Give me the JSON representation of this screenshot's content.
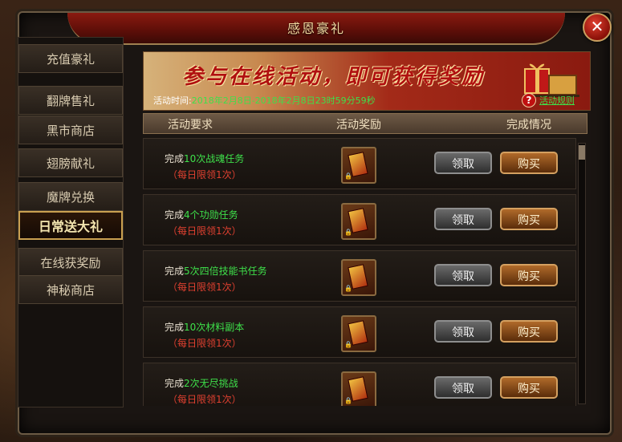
{
  "window": {
    "title": "感恩豪礼"
  },
  "sidebar": {
    "items": [
      {
        "label": "充值豪礼",
        "active": false
      },
      {
        "label": "翻牌售礼",
        "active": false
      },
      {
        "label": "黑市商店",
        "active": false
      },
      {
        "label": "翅膀献礼",
        "active": false
      },
      {
        "label": "魔牌兑换",
        "active": false
      },
      {
        "label": "日常送大礼",
        "active": true
      },
      {
        "label": "在线获奖励",
        "active": false
      },
      {
        "label": "神秘商店",
        "active": false
      }
    ]
  },
  "banner": {
    "headline": "参与在线活动，即可获得奖励",
    "time_label": "活动时间:",
    "time_value": "2018年2月8日-2018年2月8日23时59分59秒",
    "rules_link": "活动规则"
  },
  "columns": {
    "requirement": "活动要求",
    "reward": "活动奖励",
    "status": "完成情况"
  },
  "rows": [
    {
      "prefix": "完成",
      "highlight": "10次战魂任务",
      "suffix": "",
      "limit": "（每日限领1次）",
      "claim": "领取",
      "buy": "购买"
    },
    {
      "prefix": "完成",
      "highlight": "4个功勋任务",
      "suffix": "",
      "limit": "（每日限领1次）",
      "claim": "领取",
      "buy": "购买"
    },
    {
      "prefix": "完成",
      "highlight": "5次四倍技能书任务",
      "suffix": "",
      "limit": "（每日限领1次）",
      "claim": "领取",
      "buy": "购买"
    },
    {
      "prefix": "完成",
      "highlight": "10次材料副本",
      "suffix": "",
      "limit": "（每日限领1次）",
      "claim": "领取",
      "buy": "购买"
    },
    {
      "prefix": "完成",
      "highlight": "2次无尽挑战",
      "suffix": "",
      "limit": "（每日限领1次）",
      "claim": "领取",
      "buy": "购买"
    }
  ],
  "colors": {
    "accent_green": "#3ee04a",
    "limit_red": "#e04030",
    "gold": "#c9a050"
  },
  "icons": {
    "close": "close-icon",
    "help": "help-icon",
    "reward": "card-icon"
  }
}
